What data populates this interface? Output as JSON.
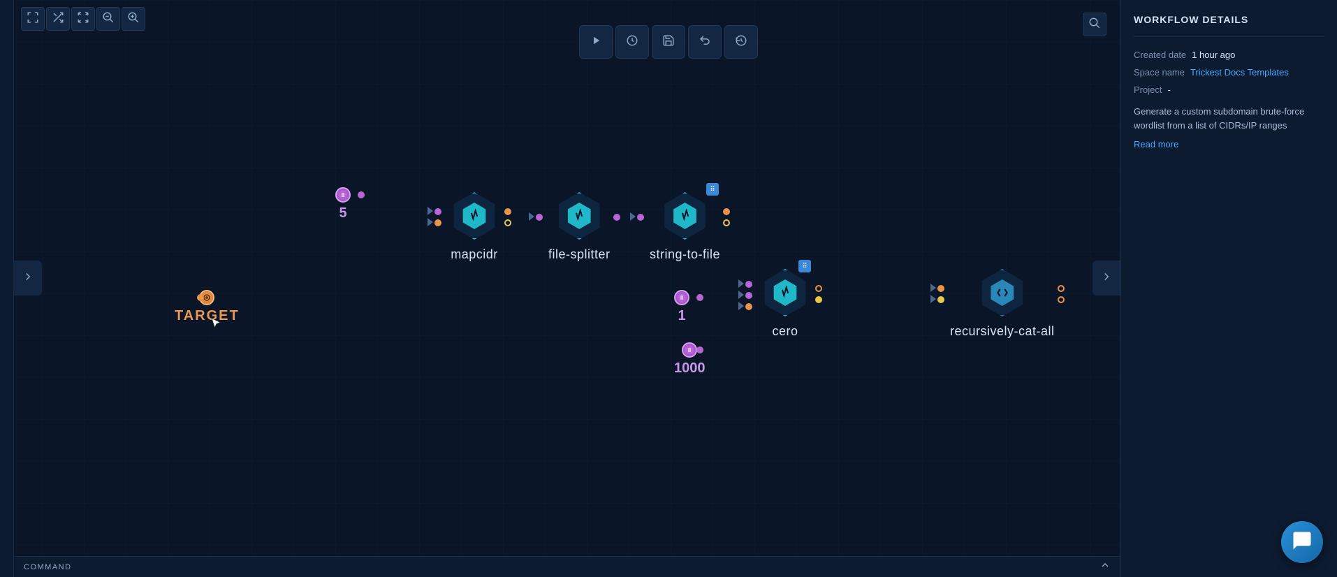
{
  "details": {
    "title": "WORKFLOW DETAILS",
    "created_label": "Created date",
    "created_value": "1 hour ago",
    "space_label": "Space name",
    "space_value": "Trickest Docs Templates",
    "project_label": "Project",
    "project_value": "-",
    "description": "Generate a custom subdomain brute-force wordlist from a list of CIDRs/IP ranges",
    "read_more": "Read more"
  },
  "nodes": {
    "target": {
      "label": "TARGET"
    },
    "five": {
      "label": "5"
    },
    "mapcidr": {
      "label": "mapcidr"
    },
    "file_splitter": {
      "label": "file-splitter"
    },
    "string_to_file": {
      "label": "string-to-file"
    },
    "one": {
      "label": "1"
    },
    "thousand": {
      "label": "1000"
    },
    "cero": {
      "label": "cero"
    },
    "recursively_cat_all": {
      "label": "recursively-cat-all"
    }
  },
  "command": {
    "label": "COMMAND"
  },
  "toolbar": {
    "fullscreen": "fullscreen",
    "shuffle": "shuffle",
    "arrows": "arrows",
    "zoom_out": "zoom-out",
    "zoom_in": "zoom-in",
    "play": "play",
    "schedule": "schedule",
    "save": "save",
    "undo": "undo",
    "history": "history",
    "search": "search"
  }
}
